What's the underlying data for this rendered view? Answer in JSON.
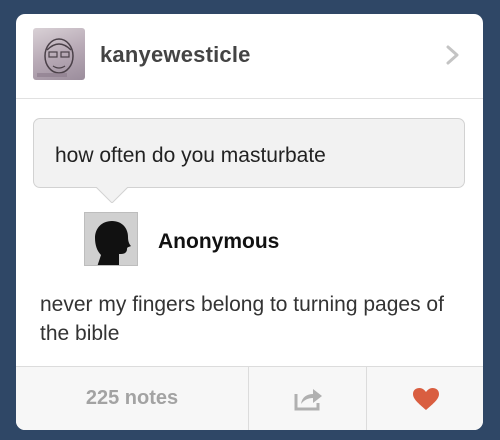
{
  "post": {
    "username": "kanyewesticle",
    "question": "how often do you masturbate",
    "asker": "Anonymous",
    "answer": "never my fingers belong to turning pages of the bible"
  },
  "footer": {
    "notes_label": "225 notes"
  },
  "icons": {
    "header_chevron": "chevron-right-icon",
    "share": "share-icon",
    "like": "heart-icon"
  },
  "colors": {
    "background": "#2f4766",
    "like": "#d95e40",
    "notes_text": "#a3a3a3"
  }
}
